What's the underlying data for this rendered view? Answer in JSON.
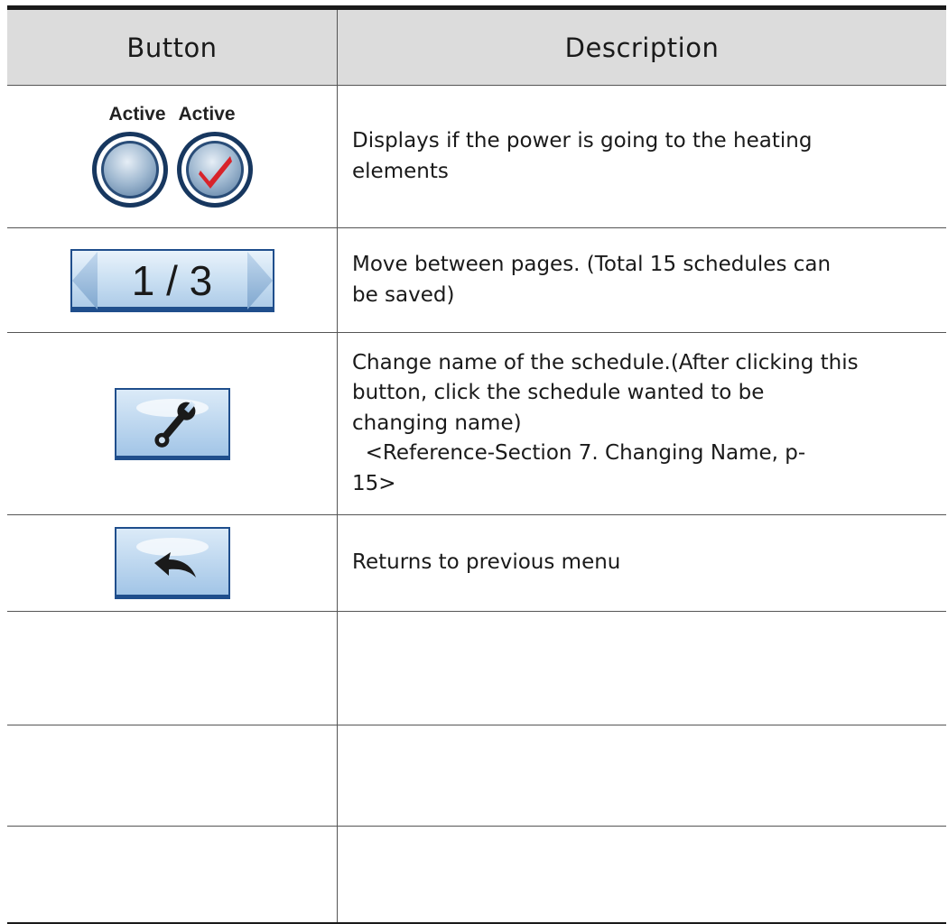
{
  "header": {
    "col_button": "Button",
    "col_description": "Description"
  },
  "rows": [
    {
      "icon": "active-indicator-icon",
      "icon_labels": [
        "Active",
        "Active"
      ],
      "description": [
        "Displays if the power is going to the heating",
        "elements"
      ]
    },
    {
      "icon": "page-navigation-icon",
      "pager_text": "1 / 3",
      "description": [
        "Move between pages. (Total 15 schedules can",
        "be saved)"
      ]
    },
    {
      "icon": "wrench-icon",
      "description": [
        "Change name of the schedule.(After clicking this",
        "button, click the schedule wanted to be",
        "changing name)",
        "  <Reference-Section 7. Changing Name, p-",
        "15>"
      ]
    },
    {
      "icon": "back-arrow-icon",
      "description": [
        "Returns to previous menu"
      ]
    }
  ],
  "colors": {
    "header_bg": "#dcdcdc",
    "button_blue": "#1f4e8c",
    "check_red": "#d8232a"
  }
}
